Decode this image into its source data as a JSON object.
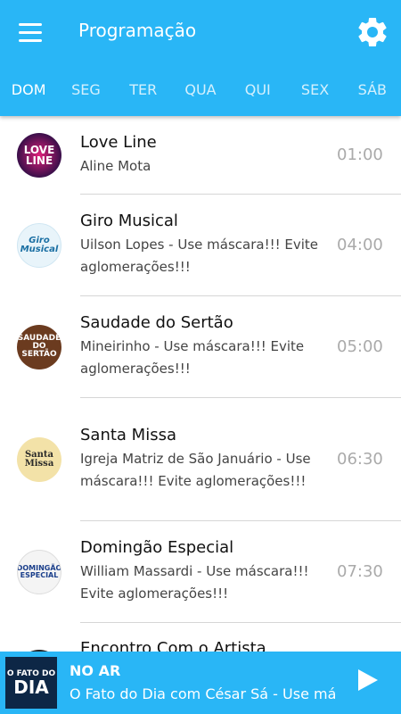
{
  "header": {
    "title": "Programação",
    "menu_icon": "hamburger-menu-icon",
    "settings_icon": "gear-icon",
    "color": "#29b6f6"
  },
  "tabs": [
    {
      "label": "DOM",
      "active": true
    },
    {
      "label": "SEG",
      "active": false
    },
    {
      "label": "TER",
      "active": false
    },
    {
      "label": "QUA",
      "active": false
    },
    {
      "label": "QUI",
      "active": false
    },
    {
      "label": "SEX",
      "active": false
    },
    {
      "label": "SÁB",
      "active": false
    }
  ],
  "programs": [
    {
      "name": "Love Line",
      "host": "Aline Mota",
      "time": "01:00",
      "logo_text": "LOVE LINE"
    },
    {
      "name": "Giro Musical",
      "host": "Uilson Lopes - Use máscara!!! Evite aglomerações!!!",
      "time": "04:00",
      "logo_text": "Giro Musical"
    },
    {
      "name": "Saudade do Sertão",
      "host": "Mineirinho - Use máscara!!! Evite aglomerações!!!",
      "time": "05:00",
      "logo_text": "SAUDADE DO SERTÃO"
    },
    {
      "name": "Santa Missa",
      "host": "Igreja Matriz de São Januário - Use máscara!!! Evite aglomerações!!!",
      "time": "06:30",
      "logo_text": "Santa Missa"
    },
    {
      "name": "Domingão Especial",
      "host": "William Massardi - Use máscara!!! Evite aglomerações!!!",
      "time": "07:30",
      "logo_text": "DOMINGÃO ESPECIAL"
    },
    {
      "name": "Encontro Com o Artista",
      "host": "",
      "time": "",
      "logo_text": ""
    }
  ],
  "player": {
    "thumb_line1": "O FATO DO",
    "thumb_line2": "DIA",
    "status": "NO AR",
    "now_playing": "O Fato do Dia com César Sá - Use más",
    "play_icon": "play-icon"
  }
}
